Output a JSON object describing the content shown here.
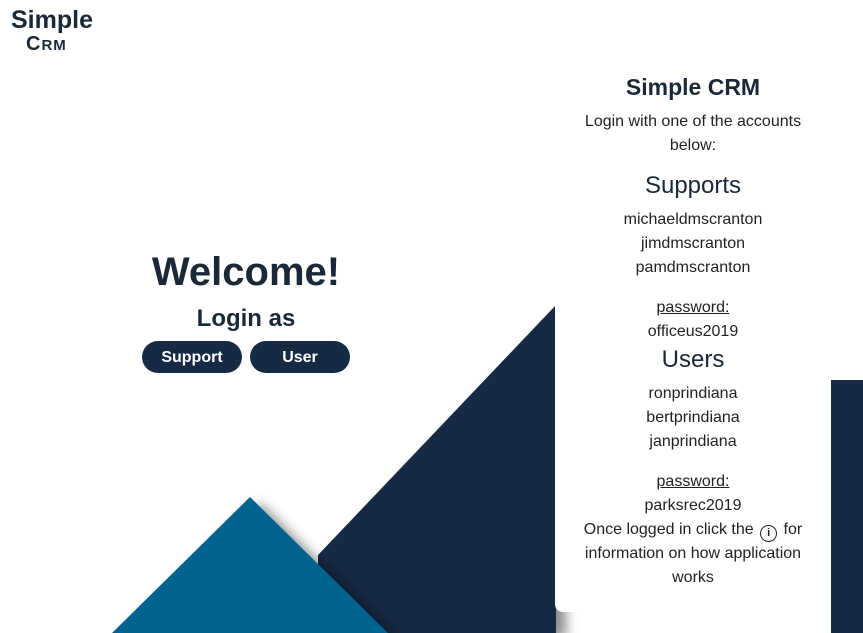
{
  "logo": {
    "line1": "Simple",
    "line2_c": "C",
    "line2_rest": "RM"
  },
  "welcome": {
    "title": "Welcome!",
    "subtitle": "Login as",
    "buttons": {
      "support": "Support",
      "user": "User"
    }
  },
  "card": {
    "title": "Simple CRM",
    "subtitle": "Login with one of the accounts below:",
    "supports": {
      "heading": "Supports",
      "accounts": [
        "michaeldmscranton",
        "jimdmscranton",
        "pamdmscranton"
      ],
      "password_label": "password:",
      "password": "officeus2019"
    },
    "users": {
      "heading": "Users",
      "accounts": [
        "ronprindiana",
        "bertprindiana",
        "janprindiana"
      ],
      "password_label": "password:",
      "password": "parksrec2019"
    },
    "note": {
      "before": "Once logged in click the",
      "icon": "info-icon",
      "after": "for information on how application works"
    }
  },
  "colors": {
    "navy": "#162a44",
    "blue": "#02628f",
    "text": "#1b2838"
  }
}
